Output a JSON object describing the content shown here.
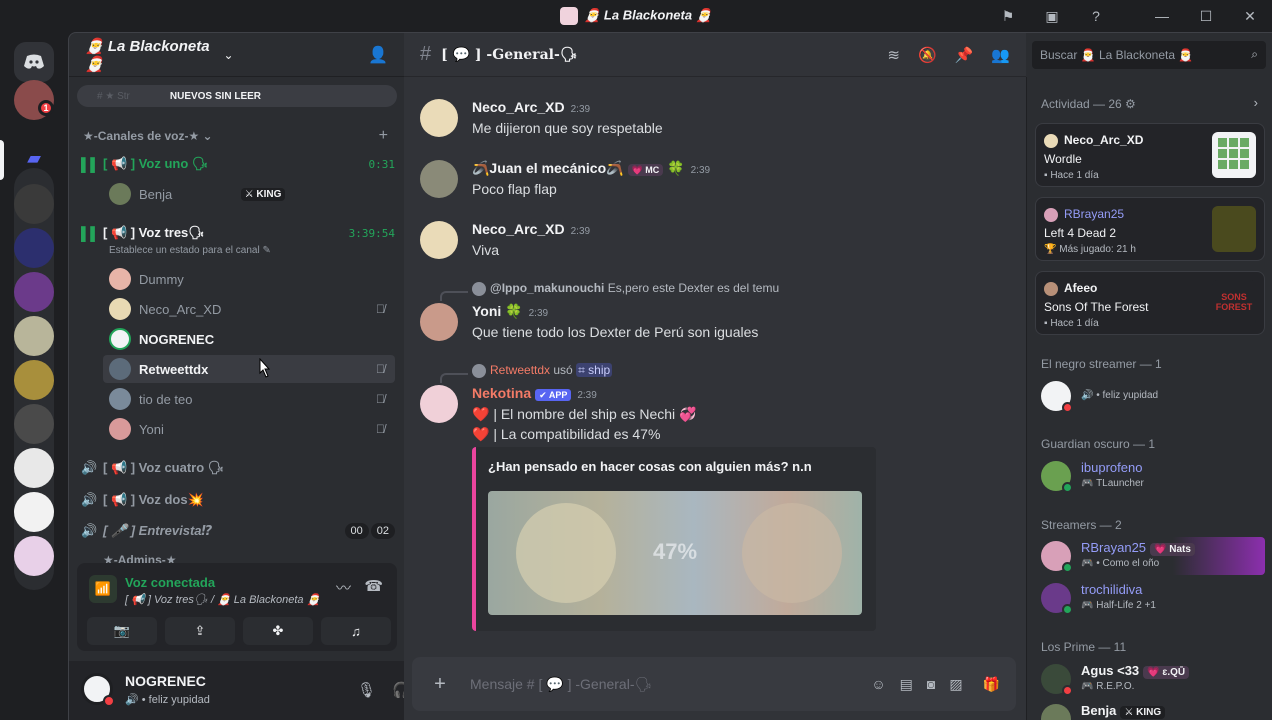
{
  "window": {
    "title": "🎅 La Blackoneta 🎅",
    "controls": [
      "inbox-icon",
      "help-icon",
      "minimize-icon",
      "maximize-icon",
      "close-icon"
    ]
  },
  "colors": {
    "accent": "#5865f2",
    "online": "#23a55a",
    "dnd": "#f23f43",
    "embed_bar": "#eb459e",
    "link": "#949cf7"
  },
  "rail": {
    "mention_badge": "1"
  },
  "server": {
    "name": "🎅 La Blackoneta 🎅",
    "unread_banner": "NUEVOS SIN LEER",
    "unread_ghost": "#   ★   Str",
    "voice_category": "★-Canales de voz-★",
    "voice_channels": [
      {
        "name": "[ 📢 ] Voz uno 🗣",
        "timer": "0:31",
        "active": true
      },
      {
        "name": "[ 📢 ] Voz tres🗣",
        "timer": "3:39:54",
        "active": true,
        "status": "Establece un estado para el canal"
      },
      {
        "name": "[ 📢 ] Voz cuatro 🗣",
        "active": false
      },
      {
        "name": "[ 📢 ] Voz dos💥",
        "active": false
      },
      {
        "name": "[ 🎤 ] Entrevista⁉",
        "active": false,
        "count_a": "00",
        "count_b": "02"
      }
    ],
    "next_category": "★-Admins-★",
    "voz_uno_users": [
      {
        "name": "Benja",
        "tag": "⚔ KING"
      }
    ],
    "voz_tres_users": [
      {
        "name": "Dummy"
      },
      {
        "name": "Neco_Arc_XD"
      },
      {
        "name": "NOGRENEC"
      },
      {
        "name": "Retweettdx"
      },
      {
        "name": "tio de teo"
      },
      {
        "name": "Yoni"
      }
    ]
  },
  "voice_panel": {
    "title": "Voz conectada",
    "subtitle": "[ 📢 ] Voz tres🗣 / 🎅 La Blackoneta 🎅"
  },
  "user_panel": {
    "name": "NOGRENEC",
    "status": "feliz yupidad"
  },
  "channel": {
    "name": "[ 💬 ] -General-🗣",
    "composer_placeholder": "Mensaje # [ 💬 ] -General-🗣"
  },
  "messages": [
    {
      "author": "Neco_Arc_XD",
      "time": "2:39",
      "text": "Me dijieron que soy respetable"
    },
    {
      "author": "🪃Juan el mecánico🪃",
      "tag": "💗 MC",
      "time": "2:39",
      "text": "Poco flap flap"
    },
    {
      "author": "Neco_Arc_XD",
      "time": "2:39",
      "text": "Viva"
    },
    {
      "reply_author": "@Ippo_makunouchi",
      "reply_text": "Es,pero este Dexter es del temu",
      "author": "Yoni",
      "time": "2:39",
      "text": "Que tiene todo los Dexter de Perú son iguales"
    },
    {
      "reply_author": "Retweettdx",
      "reply_mid": "usó",
      "reply_cmd": "⌗ ship",
      "author": "Nekotina",
      "tag": "✔ APP",
      "time": "2:39",
      "line1": "❤️ | El nombre del ship es Nechi 💞",
      "line2": "❤️ | La compatibilidad es 47%"
    }
  ],
  "embed": {
    "title": "¿Han pensado en hacer cosas con alguien más? n.n",
    "percent": "47%"
  },
  "right": {
    "search_placeholder": "Buscar 🎅 La Blackoneta 🎅",
    "activity_header": "Actividad — 26 ⚙",
    "cards": [
      {
        "user": "Neco_Arc_XD",
        "game": "Wordle",
        "meta": "Hace 1 día"
      },
      {
        "user": "RBrayan25",
        "game": "Left 4 Dead 2",
        "meta": "Más jugado: 21 h"
      },
      {
        "user": "Afeeo",
        "game": "Sons Of The Forest",
        "meta": "Hace 1 día"
      }
    ],
    "groups": [
      {
        "title": "El negro streamer — 1",
        "members": [
          {
            "name": "",
            "status": "feliz yupidad"
          }
        ]
      },
      {
        "title": "Guardian oscuro — 1",
        "members": [
          {
            "name": "ibuprofeno",
            "status": "TLauncher"
          }
        ]
      },
      {
        "title": "Streamers — 2",
        "members": [
          {
            "name": "RBrayan25",
            "tag": "💗 Nats",
            "status": "Como el oño"
          },
          {
            "name": "trochilidiva",
            "status": "Half-Life 2 +1"
          }
        ]
      },
      {
        "title": "Los Prime — 11",
        "members": [
          {
            "name": "Agus <33",
            "tag": "💗 ɛ.QŪ",
            "status": "R.E.P.O."
          },
          {
            "name": "Benja",
            "tag": "⚔ KING"
          }
        ]
      }
    ]
  }
}
